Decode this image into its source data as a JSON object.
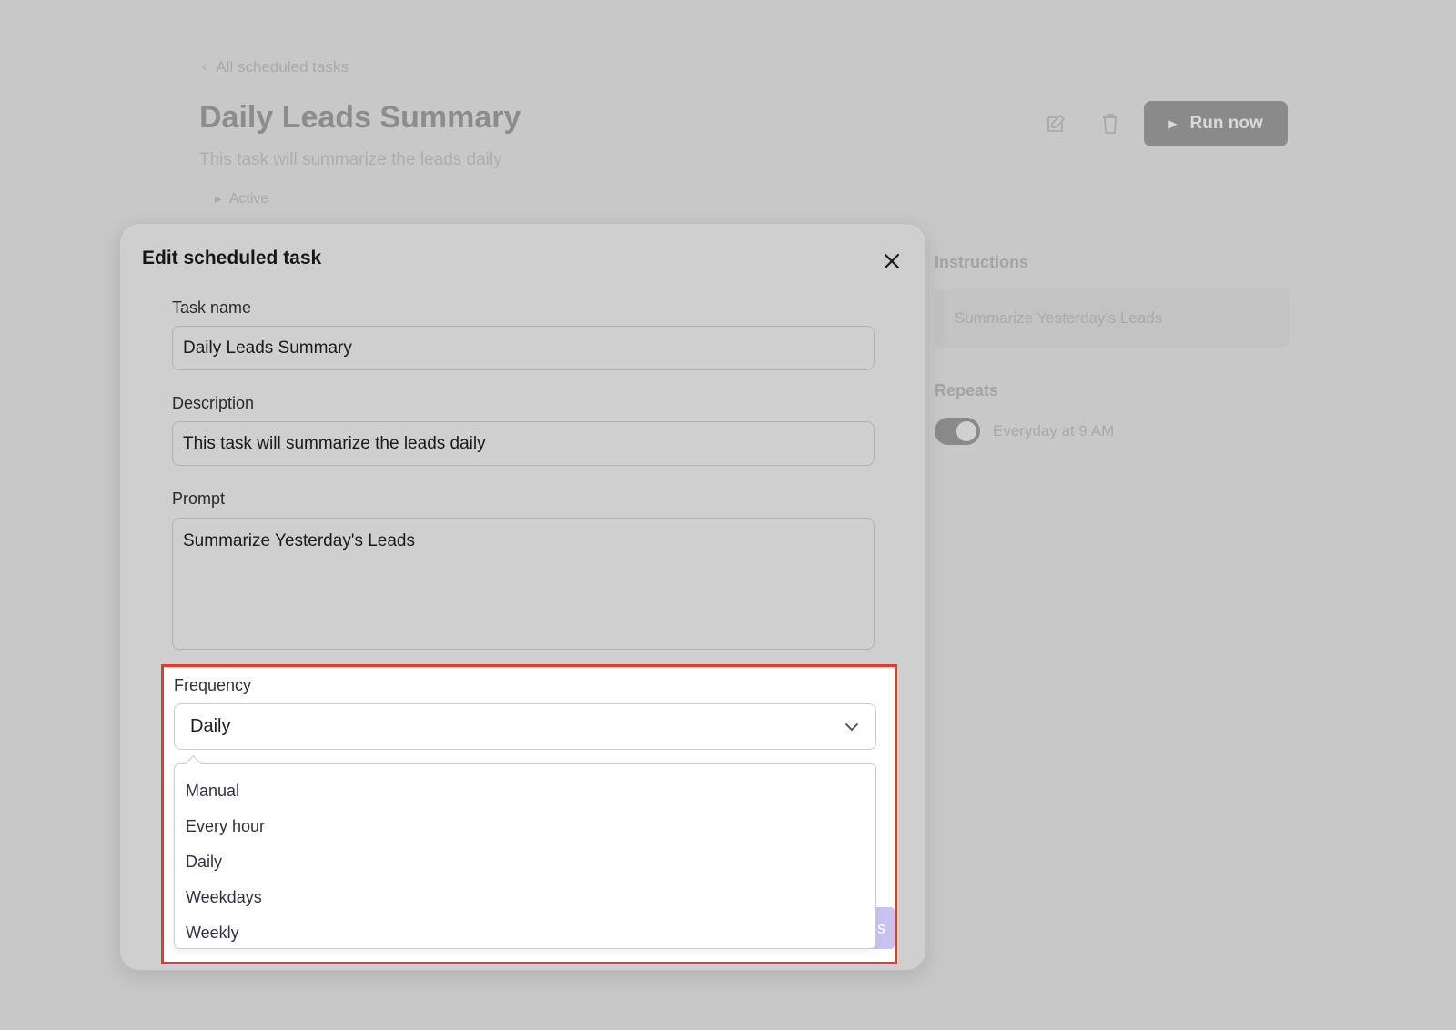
{
  "background": {
    "back_link": "All scheduled tasks",
    "title": "Daily Leads Summary",
    "subtitle": "This task will summarize the leads daily",
    "status": "Active",
    "run_button": "Run now",
    "instructions_label": "Instructions",
    "instructions_value": "Summarize Yesterday's Leads",
    "repeats_label": "Repeats",
    "repeats_value": "Everyday at 9 AM",
    "repeats_enabled": true
  },
  "modal": {
    "title": "Edit scheduled task",
    "fields": {
      "task_name_label": "Task name",
      "task_name_value": "Daily Leads Summary",
      "description_label": "Description",
      "description_value": "This task will summarize the leads daily",
      "prompt_label": "Prompt",
      "prompt_value": "Summarize Yesterday's Leads"
    },
    "frequency": {
      "label": "Frequency",
      "selected": "Daily",
      "options": [
        "Manual",
        "Every hour",
        "Daily",
        "Weekdays",
        "Weekly"
      ]
    },
    "save_button_partial": "s"
  },
  "colors": {
    "highlight_border": "#e53a2f",
    "primary_button": "#c7c3f3",
    "overlay": "#c8c8c8"
  }
}
